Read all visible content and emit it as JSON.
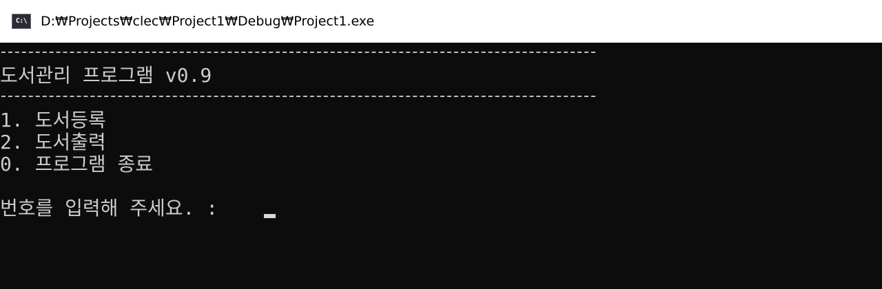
{
  "window": {
    "title": "D:₩Projects₩clec₩Project1₩Debug₩Project1.exe",
    "icon_name": "console-app-icon",
    "icon_text": "C:\\"
  },
  "console": {
    "rule_top": "-------------------------------------------------",
    "header": "도서관리 프로그램 v0.9",
    "rule_bottom": "-------------------------------------------------",
    "menu": [
      "1. 도서등록",
      "2. 도서출력",
      "0. 프로그램 종료"
    ],
    "prompt": "번호를 입력해 주세요. : "
  },
  "colors": {
    "background": "#0c0c0c",
    "text": "#cccccc",
    "titlebar": "#ffffff"
  }
}
